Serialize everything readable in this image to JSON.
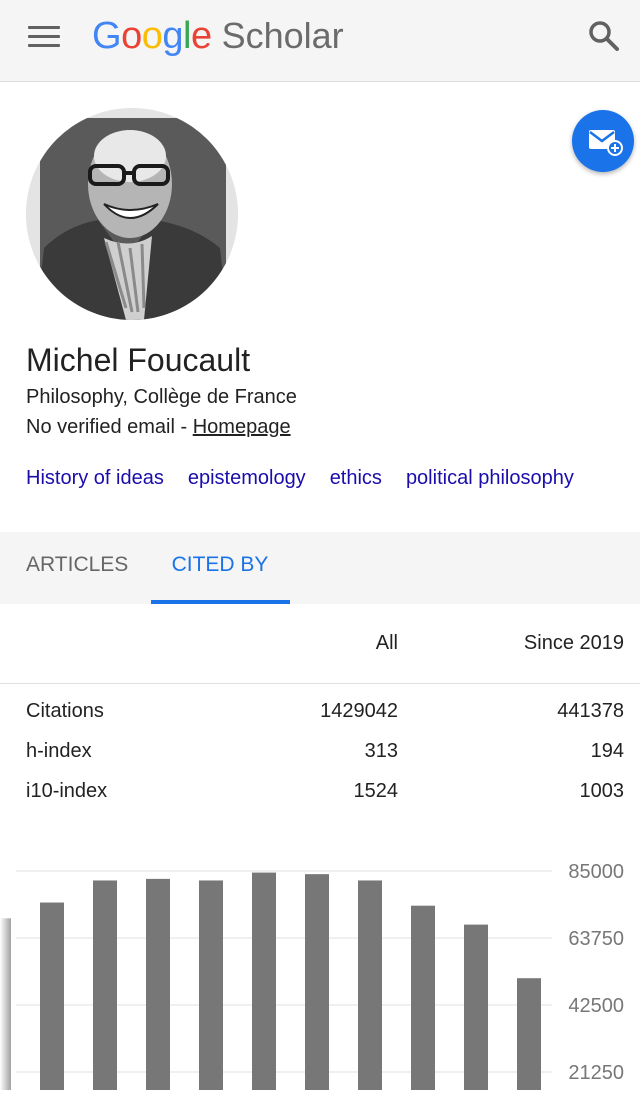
{
  "header": {
    "logo_google": [
      "G",
      "o",
      "o",
      "g",
      "l",
      "e"
    ],
    "logo_colors": [
      "#4285f4",
      "#ea4335",
      "#fbbc05",
      "#4285f4",
      "#34a853",
      "#ea4335"
    ],
    "logo_scholar": "Scholar",
    "menu_icon": "hamburger-menu-icon",
    "search_icon": "search-icon"
  },
  "profile": {
    "name": "Michel Foucault",
    "affiliation": "Philosophy, Collège de France",
    "email_text": "No verified email - ",
    "homepage_label": "Homepage",
    "follow_icon": "email-follow-icon",
    "interests": [
      "History of ideas",
      "epistemology",
      "ethics",
      "political philosophy"
    ]
  },
  "tabs": {
    "articles": "ARTICLES",
    "cited_by": "CITED BY"
  },
  "stats": {
    "col_all": "All",
    "col_since": "Since 2019",
    "rows": [
      {
        "label": "Citations",
        "all": "1429042",
        "since": "441378"
      },
      {
        "label": "h-index",
        "all": "313",
        "since": "194"
      },
      {
        "label": "i10-index",
        "all": "1524",
        "since": "1003"
      }
    ]
  },
  "chart_data": {
    "type": "bar",
    "values": [
      70000,
      75000,
      82000,
      82500,
      82000,
      84500,
      84000,
      82000,
      74000,
      68000,
      51000
    ],
    "yticks": [
      "85000",
      "63750",
      "42500",
      "21250"
    ],
    "ylim": [
      0,
      85000
    ],
    "bar_color": "#777777",
    "grid": true
  }
}
